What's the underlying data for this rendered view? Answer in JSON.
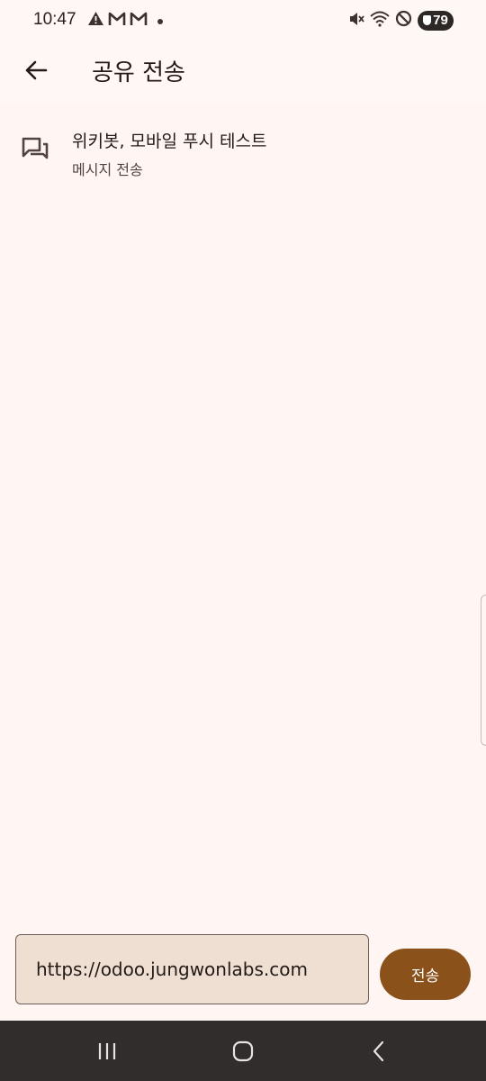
{
  "status_bar": {
    "time": "10:47",
    "battery_level": "79",
    "left_icons": [
      "warning-icon",
      "gmail-icon",
      "gmail-icon",
      "dot-icon"
    ],
    "right_icons": [
      "mute-icon",
      "wifi-icon",
      "do-not-disturb-icon",
      "battery-icon"
    ]
  },
  "app_bar": {
    "title": "공유 전송",
    "back_icon": "arrow-left-icon"
  },
  "list": {
    "items": [
      {
        "icon": "chat-bubbles-icon",
        "title": "위키봇, 모바일 푸시 테스트",
        "subtitle": "메시지 전송"
      }
    ]
  },
  "composer": {
    "input_value": "https://odoo.jungwonlabs.com",
    "send_label": "전송"
  },
  "nav_bar": {
    "buttons": [
      "recent-apps-icon",
      "home-icon",
      "back-icon"
    ]
  },
  "colors": {
    "background": "#fff6f3",
    "accent": "#8b511b",
    "input_fill": "#efdfd3",
    "nav_bar": "#302d2c"
  }
}
